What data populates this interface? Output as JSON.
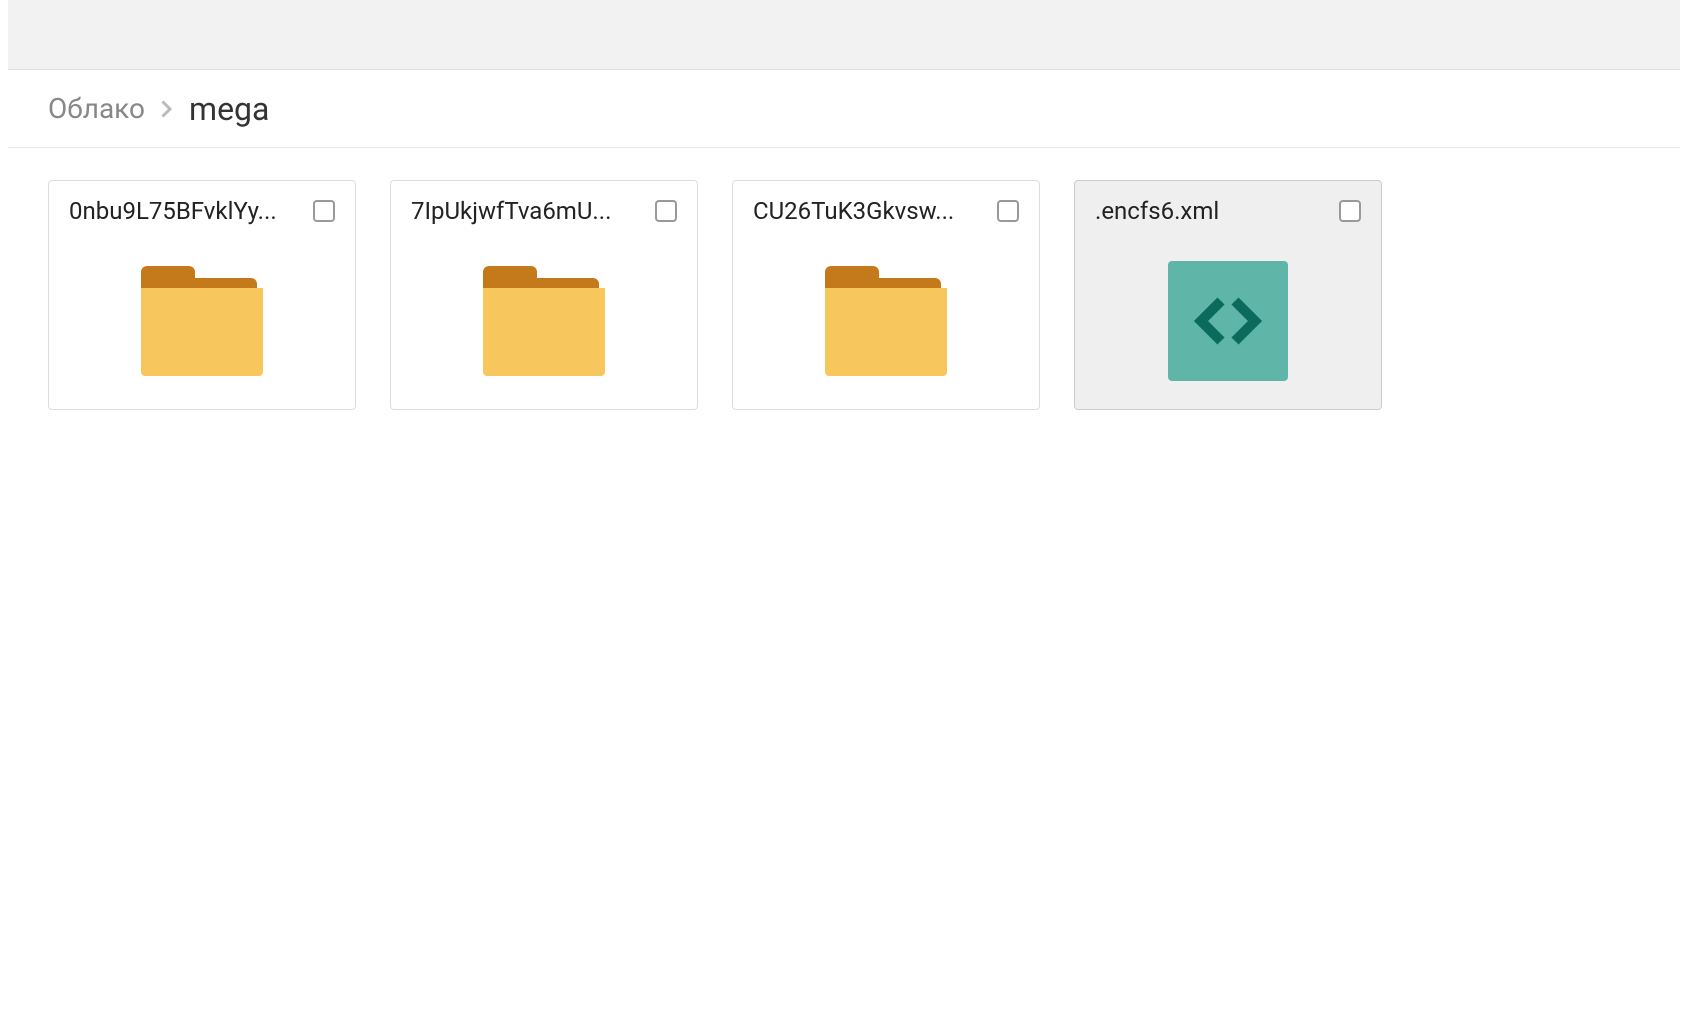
{
  "breadcrumb": {
    "root": "Облако",
    "current": "mega"
  },
  "items": [
    {
      "name": "0nbu9L75BFvklYy...",
      "type": "folder",
      "selected": false
    },
    {
      "name": "7IpUkjwfTva6mU...",
      "type": "folder",
      "selected": false
    },
    {
      "name": "CU26TuK3Gkvsw...",
      "type": "folder",
      "selected": false
    },
    {
      "name": ".encfs6.xml",
      "type": "code-file",
      "selected": true
    }
  ],
  "colors": {
    "folder_body": "#f7c65d",
    "folder_tab": "#c47a1a",
    "code_bg": "#5fb5a8",
    "code_fg": "#0a6b5c"
  }
}
